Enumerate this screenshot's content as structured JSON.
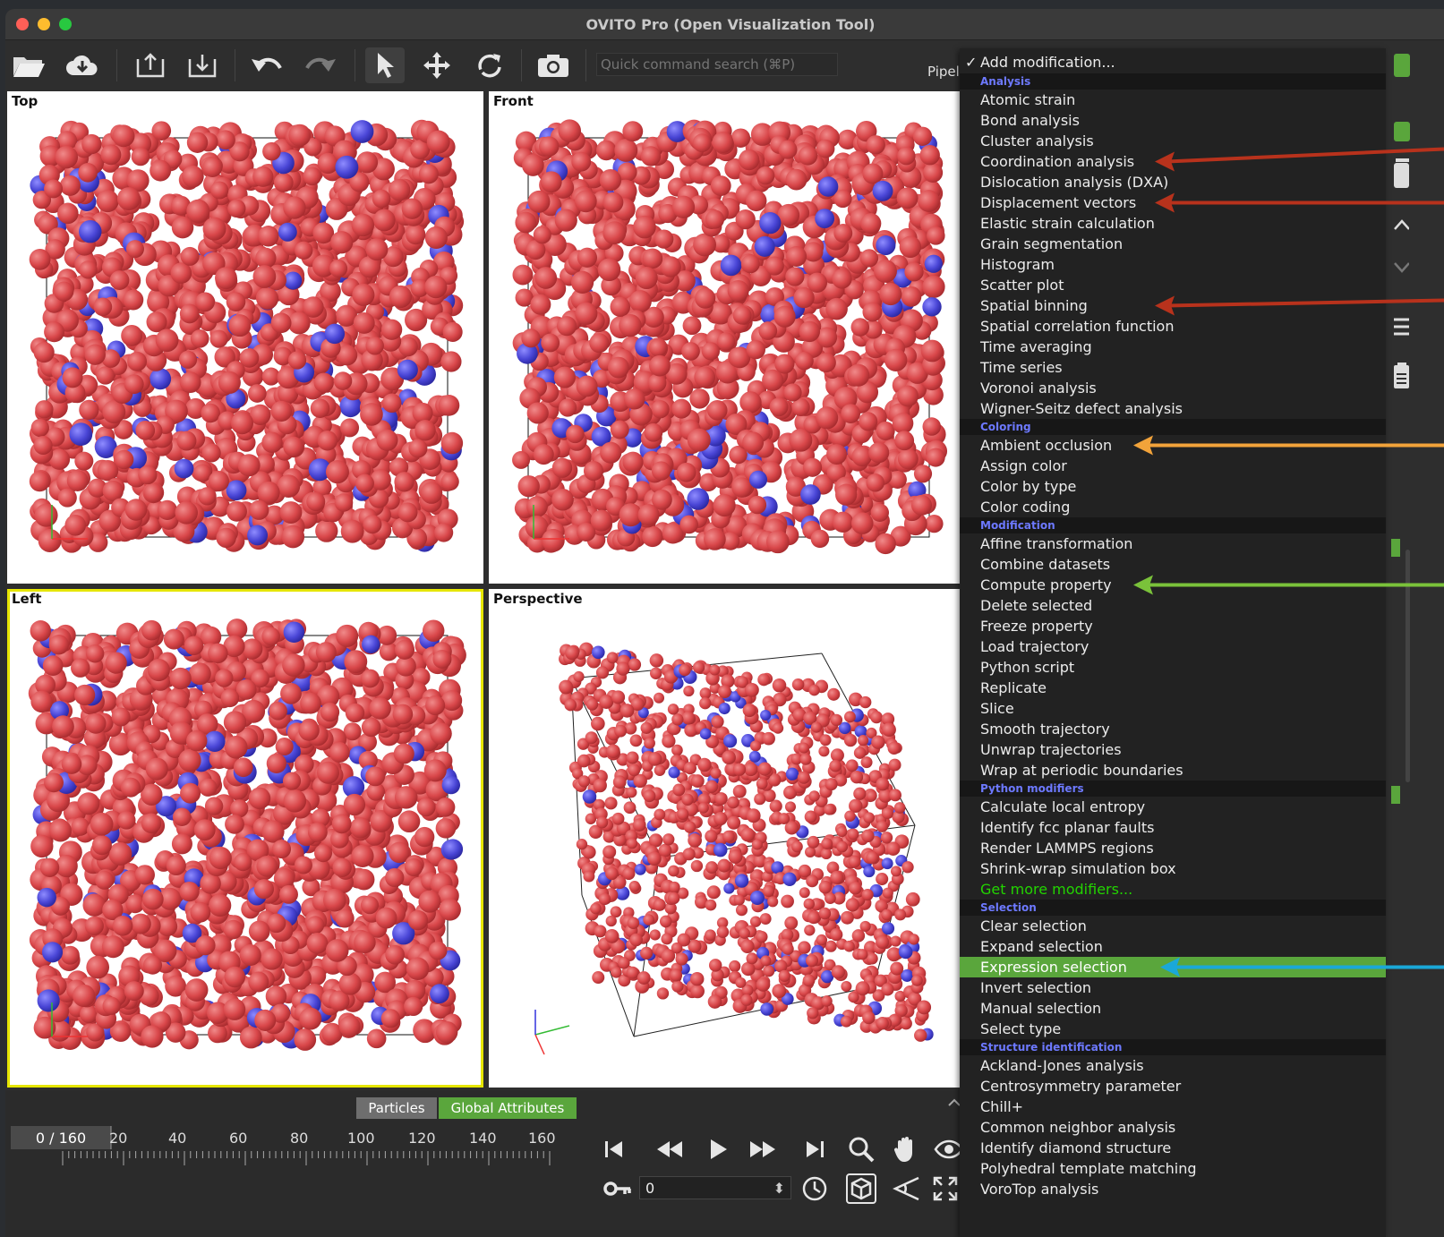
{
  "window": {
    "title": "OVITO Pro (Open Visualization Tool)"
  },
  "toolbar": {
    "search_placeholder": "Quick command search (⌘P)",
    "pipeline_label": "Pipelin"
  },
  "viewports": {
    "top": "Top",
    "front": "Front",
    "left": "Left",
    "perspective": "Perspective"
  },
  "bottom": {
    "tab_particles": "Particles",
    "tab_global": "Global Attributes",
    "frame": "0 / 160",
    "ticks": [
      "20",
      "40",
      "60",
      "80",
      "100",
      "120",
      "140",
      "160"
    ],
    "spinner_value": "0"
  },
  "menu": {
    "title": "Add modification...",
    "sections": [
      {
        "header": "Analysis",
        "items": [
          "Atomic strain",
          "Bond analysis",
          "Cluster analysis",
          "Coordination analysis",
          "Dislocation analysis (DXA)",
          "Displacement vectors",
          "Elastic strain calculation",
          "Grain segmentation",
          "Histogram",
          "Scatter plot",
          "Spatial binning",
          "Spatial correlation function",
          "Time averaging",
          "Time series",
          "Voronoi analysis",
          "Wigner-Seitz defect analysis"
        ]
      },
      {
        "header": "Coloring",
        "items": [
          "Ambient occlusion",
          "Assign color",
          "Color by type",
          "Color coding"
        ]
      },
      {
        "header": "Modification",
        "items": [
          "Affine transformation",
          "Combine datasets",
          "Compute property",
          "Delete selected",
          "Freeze property",
          "Load trajectory",
          "Python script",
          "Replicate",
          "Slice",
          "Smooth trajectory",
          "Unwrap trajectories",
          "Wrap at periodic boundaries"
        ]
      },
      {
        "header": "Python modifiers",
        "items": [
          "Calculate local entropy",
          "Identify fcc planar faults",
          "Render LAMMPS regions",
          "Shrink-wrap simulation box"
        ],
        "link": "Get more modifiers..."
      },
      {
        "header": "Selection",
        "items": [
          "Clear selection",
          "Expand selection",
          "Expression selection",
          "Invert selection",
          "Manual selection",
          "Select type"
        ]
      },
      {
        "header": "Structure identification",
        "items": [
          "Ackland-Jones analysis",
          "Centrosymmetry parameter",
          "Chill+",
          "Common neighbor analysis",
          "Identify diamond structure",
          "Polyhedral template matching",
          "VoroTop analysis"
        ]
      }
    ],
    "highlighted": "Expression selection"
  },
  "colors": {
    "atom_red": "#d9474a",
    "atom_blue": "#4a46d6",
    "menu_header": "#6d79ff",
    "highlight": "#5aa63c",
    "arrow_red": "#b8321c",
    "arrow_orange": "#f2a33a",
    "arrow_green": "#7ac23a",
    "arrow_cyan": "#1aa8d8"
  }
}
